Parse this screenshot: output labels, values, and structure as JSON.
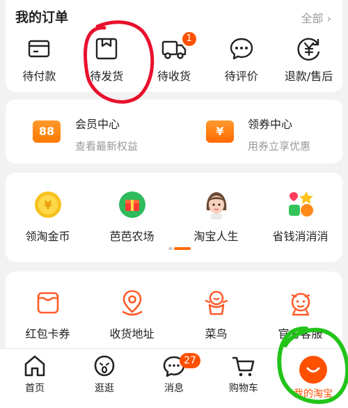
{
  "orders": {
    "title": "我的订单",
    "all": "全部 ›",
    "items": [
      {
        "label": "待付款"
      },
      {
        "label": "待发货"
      },
      {
        "label": "待收货",
        "badge": "1"
      },
      {
        "label": "待评价"
      },
      {
        "label": "退款/售后"
      }
    ]
  },
  "vip": {
    "member": {
      "icon_text": "88",
      "title": "会员中心",
      "sub": "查看最新权益"
    },
    "coupon": {
      "icon_text": "¥",
      "title": "领券中心",
      "sub": "用券立享优惠"
    }
  },
  "games": {
    "items": [
      {
        "label": "领淘金币"
      },
      {
        "label": "芭芭农场"
      },
      {
        "label": "淘宝人生"
      },
      {
        "label": "省钱消消消"
      }
    ]
  },
  "services": {
    "items": [
      {
        "label": "红包卡券"
      },
      {
        "label": "收货地址"
      },
      {
        "label": "菜鸟"
      },
      {
        "label": "官方客服"
      }
    ]
  },
  "nav": {
    "items": [
      {
        "label": "首页"
      },
      {
        "label": "逛逛"
      },
      {
        "label": "消息",
        "badge": "27"
      },
      {
        "label": "购物车"
      },
      {
        "label": "我的淘宝"
      }
    ]
  },
  "colors": {
    "accent": "#ff5000",
    "annotation_red": "#e8112d",
    "annotation_green": "#22c41a"
  }
}
